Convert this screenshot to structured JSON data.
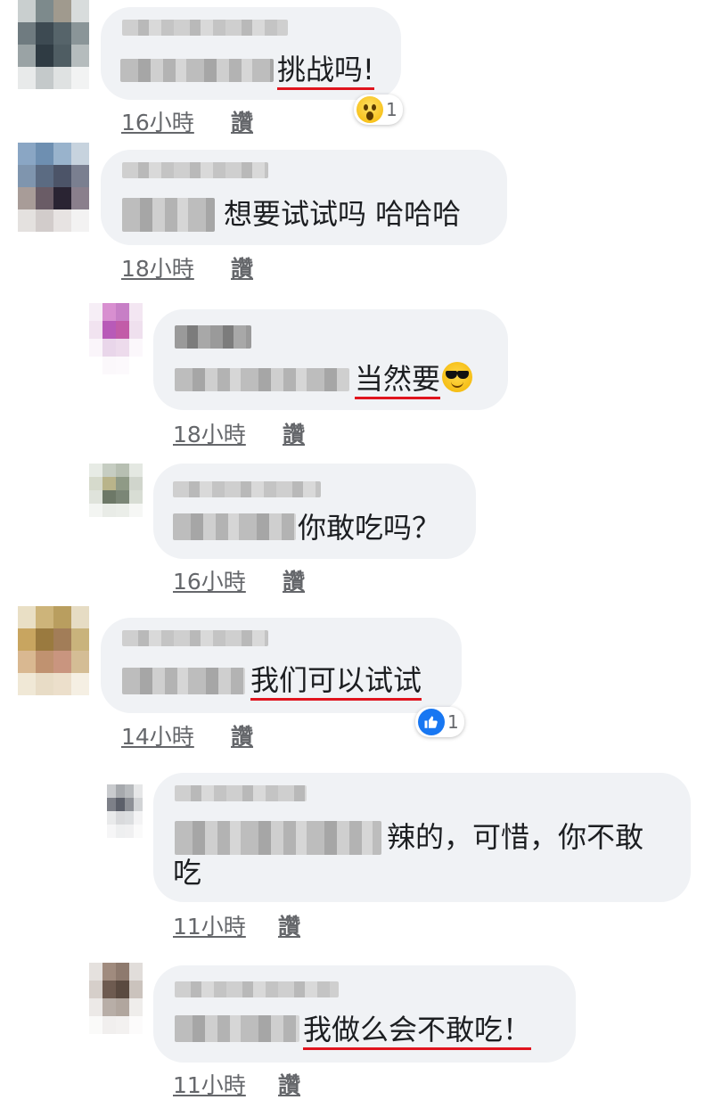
{
  "like_label": "讚",
  "comments": [
    {
      "text": "挑战吗!",
      "time": "16小時",
      "reaction": {
        "icon": "wow-icon",
        "count": "1"
      }
    },
    {
      "text": "想要试试吗 哈哈哈",
      "time": "18小時"
    },
    {
      "text": "当然要",
      "emoji": "sunglasses-face-emoji",
      "time": "18小時"
    },
    {
      "text": "你敢吃吗？",
      "time": "16小時"
    },
    {
      "text": "我们可以试试",
      "time": "14小時",
      "reaction": {
        "icon": "like-icon",
        "count": "1"
      }
    },
    {
      "text_line1": "辣的，可惜，你不敢",
      "text_line2": "吃",
      "time": "11小時"
    },
    {
      "text": "我做么会不敢吃！",
      "time": "11小時"
    }
  ],
  "colors": {
    "bubble": "#f0f2f5",
    "text": "#1c1e21",
    "meta": "#65676b",
    "underline": "#e0141e",
    "like_blue": "#1877f2"
  }
}
